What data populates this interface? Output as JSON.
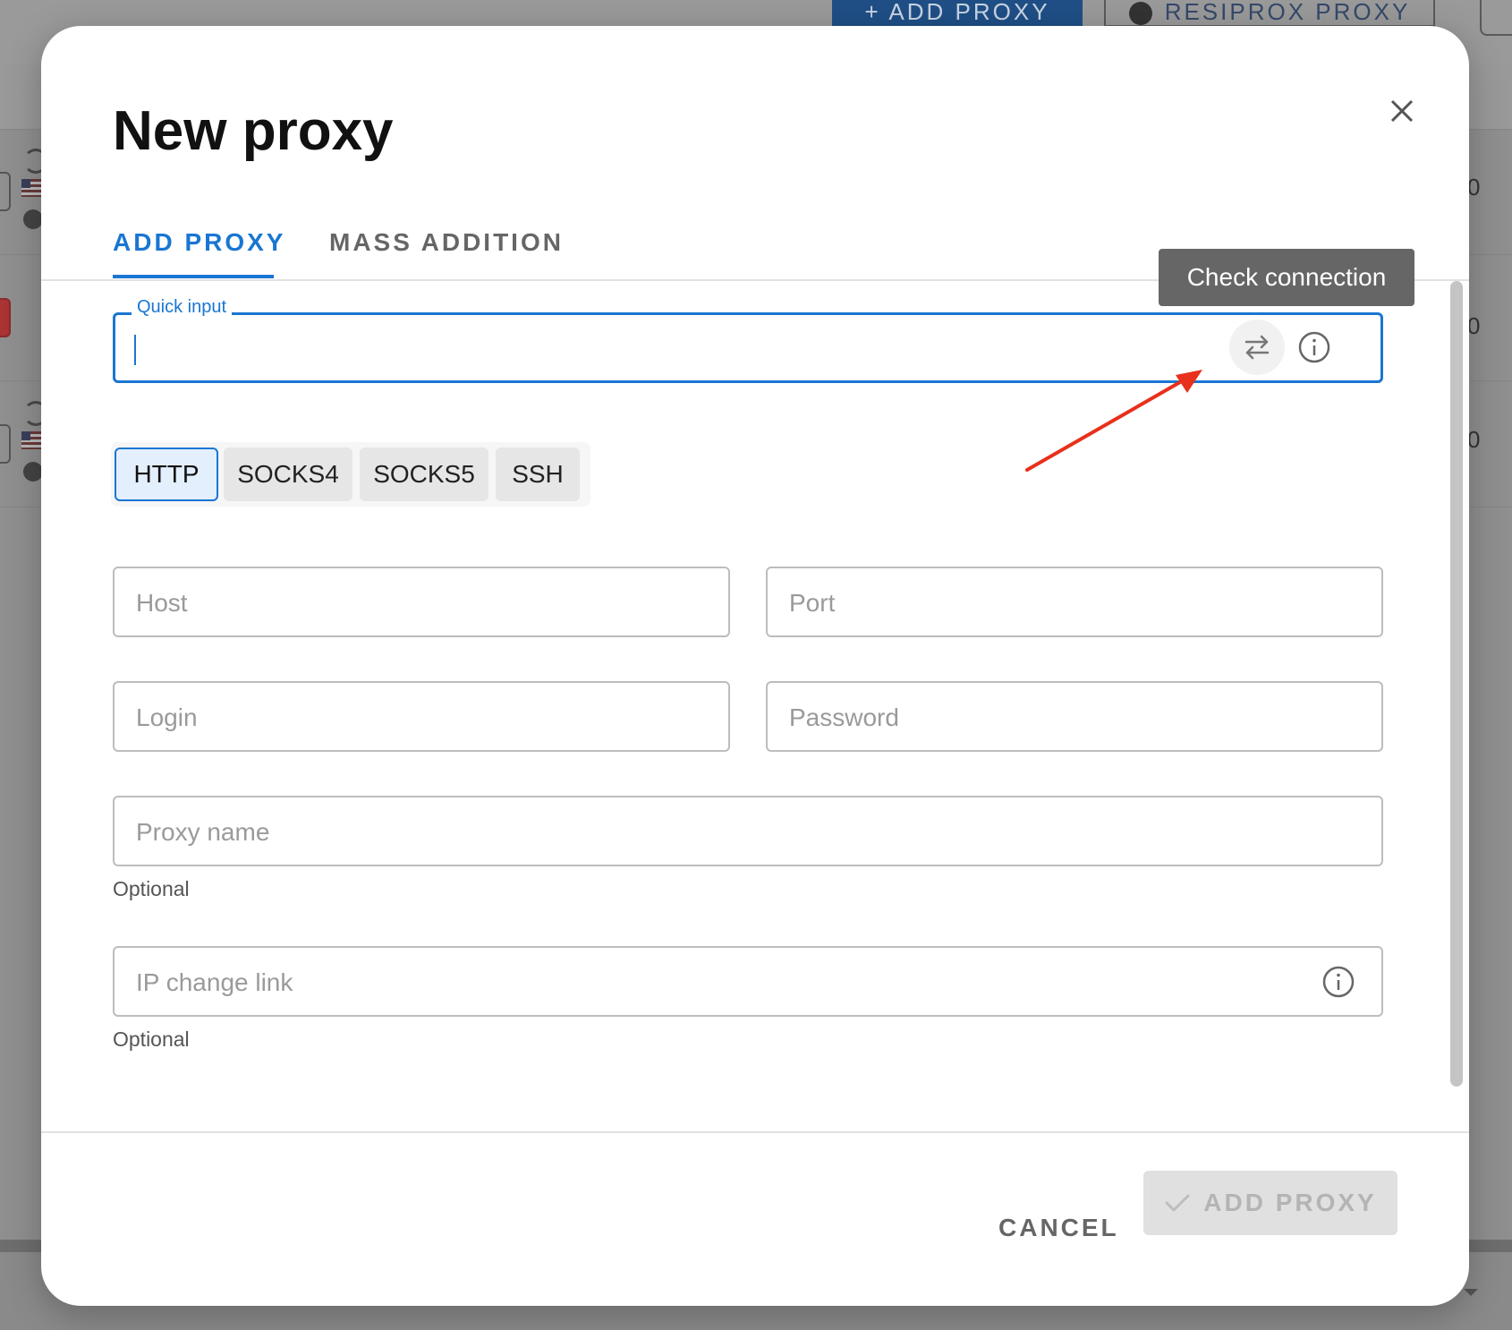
{
  "background": {
    "add_proxy_button": "+ ADD PROXY",
    "resiprox_button": "RESIPROX PROXY",
    "row_values": [
      "0",
      "0",
      "0"
    ]
  },
  "dialog": {
    "title": "New proxy",
    "tabs": [
      {
        "label": "ADD PROXY",
        "active": true
      },
      {
        "label": "MASS ADDITION",
        "active": false
      }
    ],
    "tooltip": "Check connection",
    "quick_input": {
      "label": "Quick input",
      "value": ""
    },
    "protocols": [
      {
        "label": "HTTP",
        "selected": true
      },
      {
        "label": "SOCKS4",
        "selected": false
      },
      {
        "label": "SOCKS5",
        "selected": false
      },
      {
        "label": "SSH",
        "selected": false
      }
    ],
    "fields": {
      "host": {
        "placeholder": "Host"
      },
      "port": {
        "placeholder": "Port"
      },
      "login": {
        "placeholder": "Login"
      },
      "password": {
        "placeholder": "Password"
      },
      "proxy_name": {
        "placeholder": "Proxy name",
        "helper": "Optional"
      },
      "ip_change_link": {
        "placeholder": "IP change link",
        "helper": "Optional"
      }
    },
    "footer": {
      "cancel_label": "CANCEL",
      "add_label": "ADD PROXY"
    }
  },
  "colors": {
    "accent": "#1976d2",
    "annotation_arrow": "#e8301c",
    "tooltip_bg": "#666666",
    "disabled_button_bg": "#e0e0e0"
  }
}
